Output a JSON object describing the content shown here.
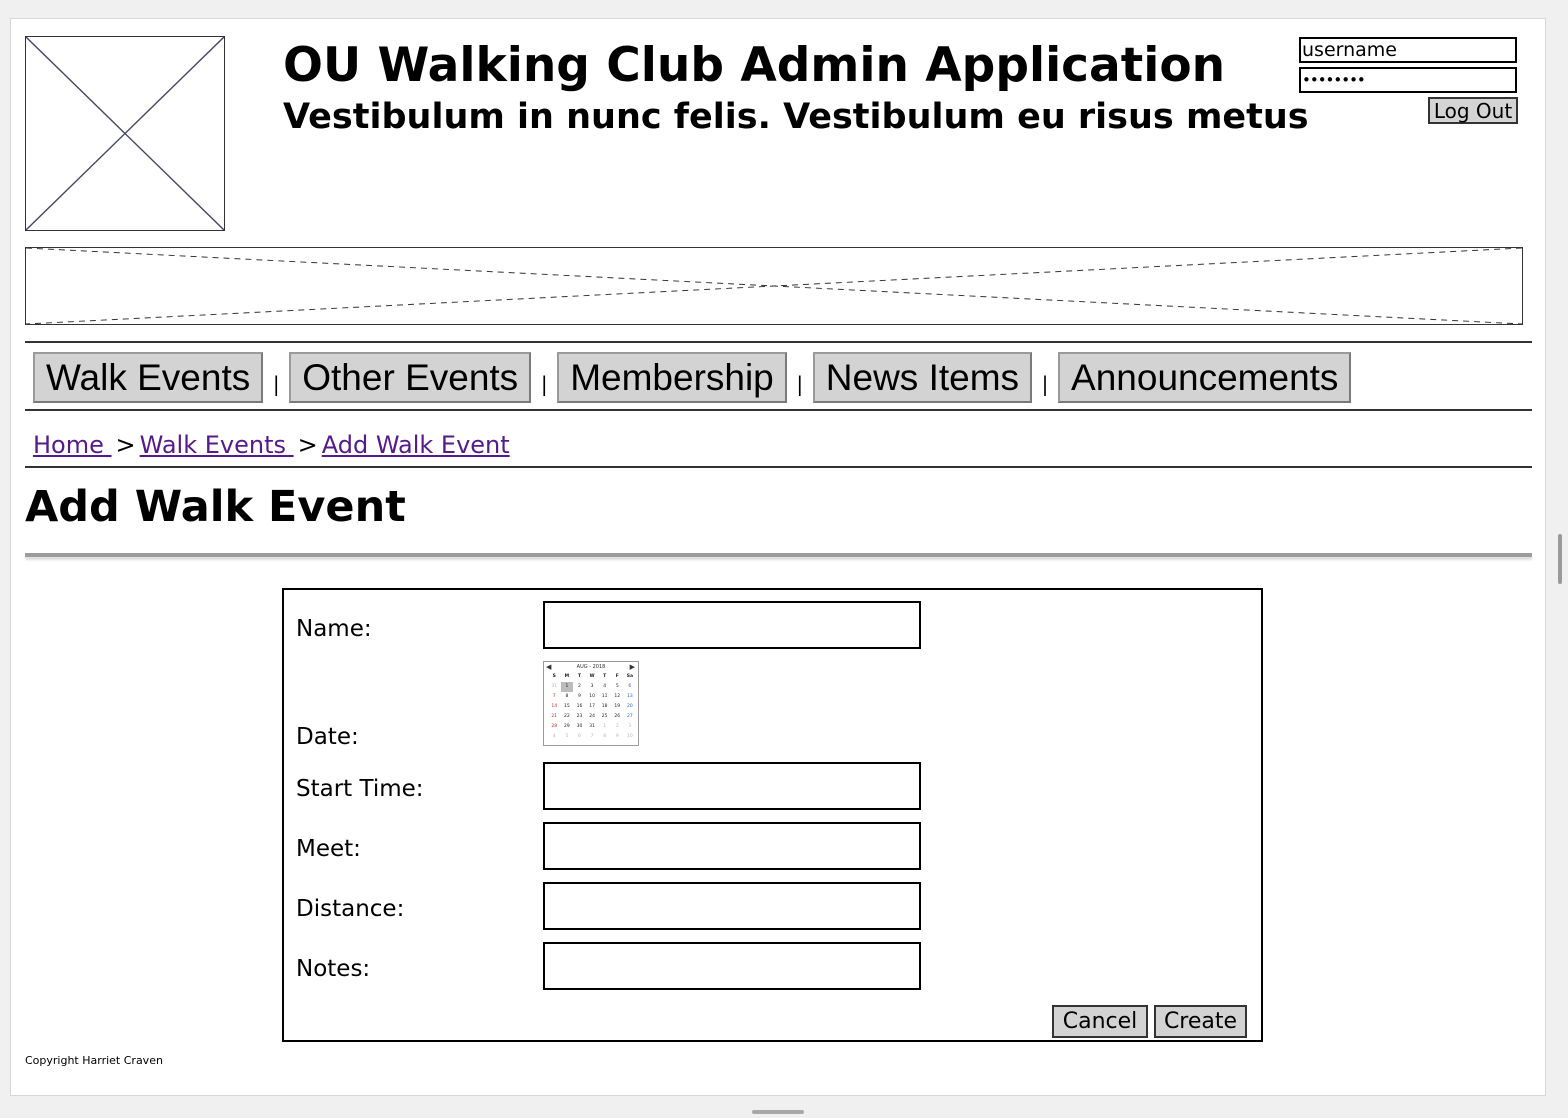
{
  "header": {
    "title": "OU Walking Club Admin Application",
    "subtitle": "Vestibulum in nunc felis. Vestibulum eu risus metus"
  },
  "login": {
    "username_value": "username",
    "password_value": "••••••••",
    "logout_label": "Log Out"
  },
  "nav": {
    "tabs": [
      {
        "label": "Walk Events"
      },
      {
        "label": "Other Events"
      },
      {
        "label": "Membership"
      },
      {
        "label": "News Items"
      },
      {
        "label": "Announcements"
      }
    ],
    "separator": "|"
  },
  "breadcrumb": {
    "items": [
      {
        "label": "Home "
      },
      {
        "label": "Walk Events "
      },
      {
        "label": "Add Walk Event"
      }
    ],
    "separator": ">"
  },
  "page": {
    "title": "Add Walk Event"
  },
  "form": {
    "name_label": "Name:",
    "date_label": "Date:",
    "start_time_label": "Start Time:",
    "meet_label": "Meet:",
    "distance_label": "Distance:",
    "notes_label": "Notes:",
    "name_value": "",
    "start_time_value": "",
    "meet_value": "",
    "distance_value": "",
    "notes_value": "",
    "cancel_label": "Cancel",
    "create_label": "Create"
  },
  "calendar": {
    "month_label": "AUG - 2018",
    "weekdays": [
      "S",
      "M",
      "T",
      "W",
      "T",
      "F",
      "Sa"
    ],
    "days": [
      "31",
      "1",
      "2",
      "3",
      "4",
      "5",
      "6",
      "7",
      "8",
      "9",
      "10",
      "11",
      "12",
      "13",
      "14",
      "15",
      "16",
      "17",
      "18",
      "19",
      "20",
      "21",
      "22",
      "23",
      "24",
      "25",
      "26",
      "27",
      "28",
      "29",
      "30",
      "31",
      "1",
      "2",
      "3",
      "4",
      "5",
      "6",
      "7",
      "8",
      "9",
      "10"
    ],
    "selected_day": "1",
    "colors": {
      "sunday": "#d02a2a",
      "saturday": "#2a5fd0",
      "outside_month": "#b5b5b5"
    }
  },
  "footer": {
    "copyright": "Copyright Harriet Craven"
  }
}
